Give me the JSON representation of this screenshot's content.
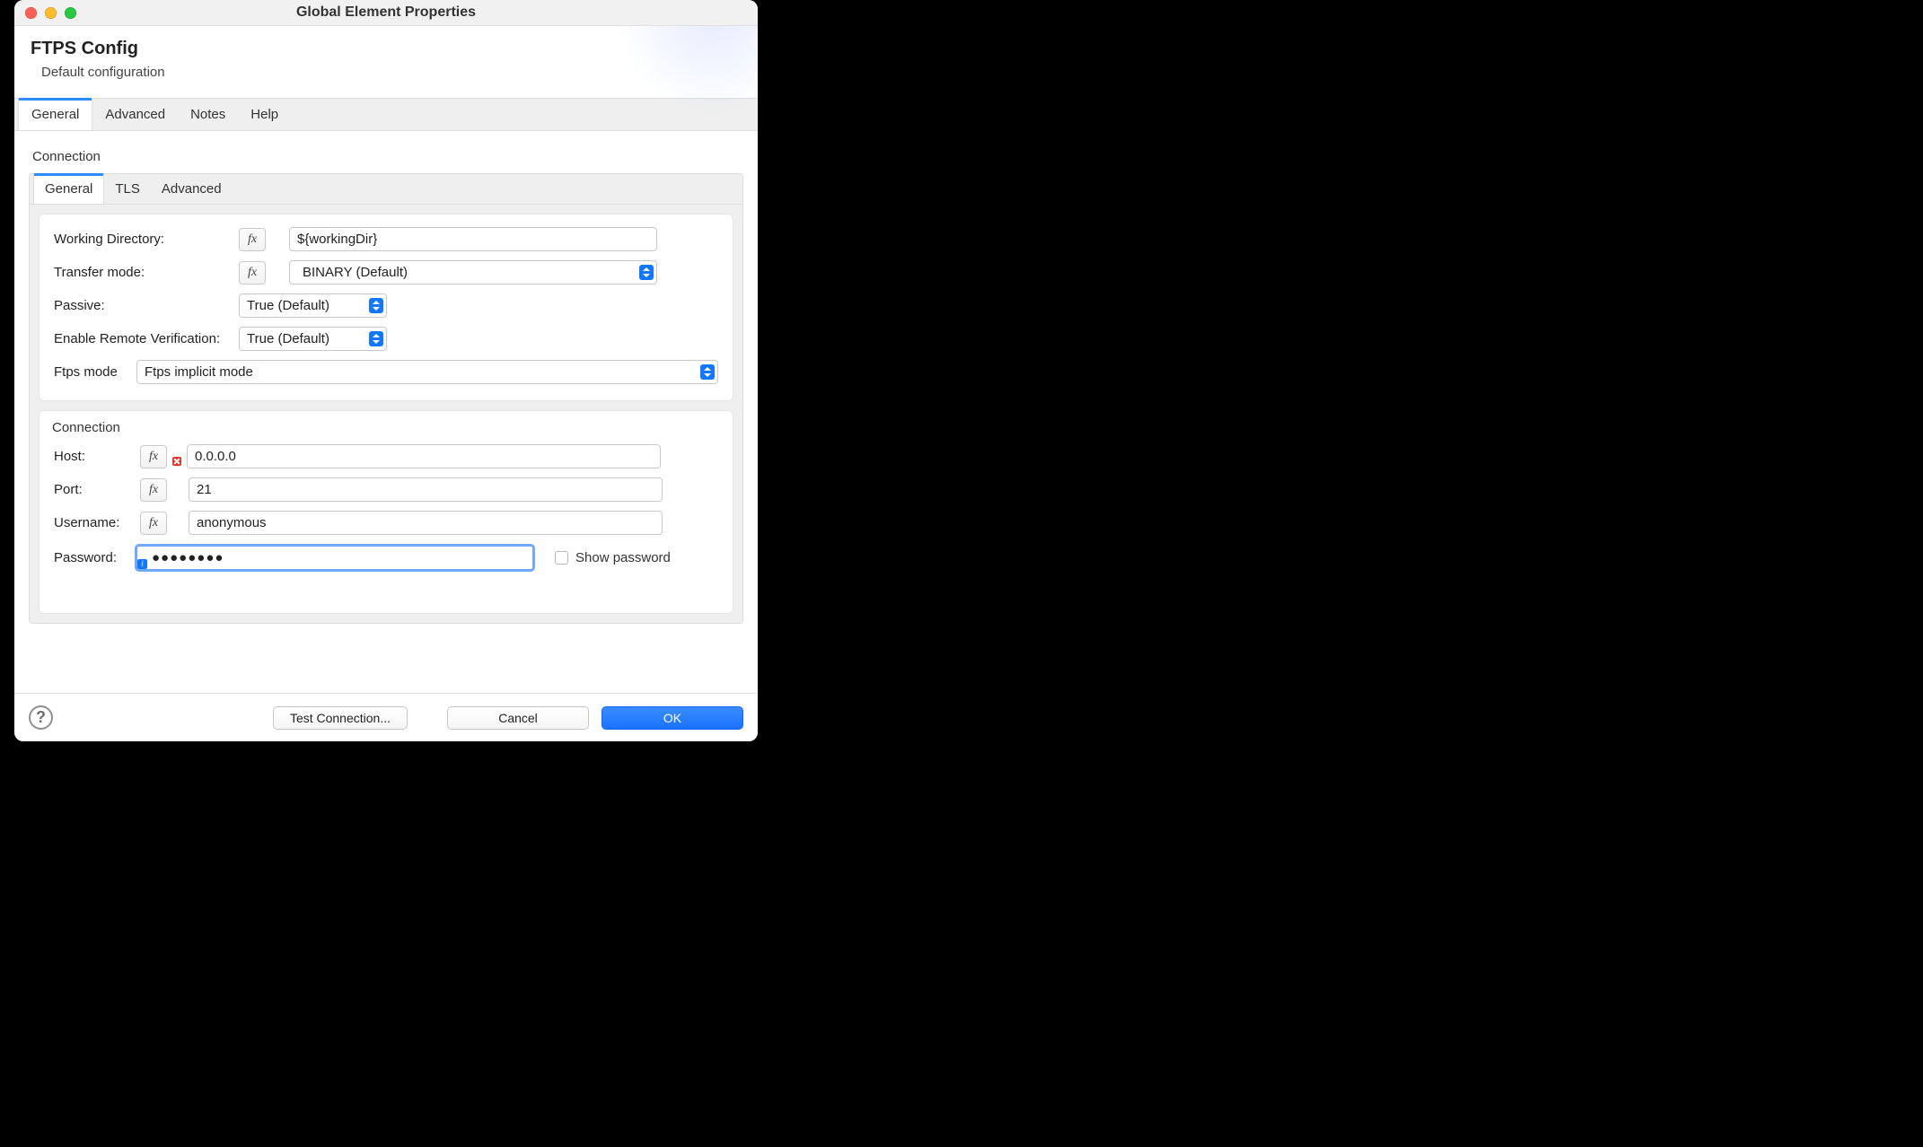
{
  "window": {
    "title": "Global Element Properties"
  },
  "header": {
    "title": "FTPS Config",
    "subtitle": "Default configuration"
  },
  "outerTabs": [
    "General",
    "Advanced",
    "Notes",
    "Help"
  ],
  "section": {
    "connection_label": "Connection"
  },
  "innerTabs": [
    "General",
    "TLS",
    "Advanced"
  ],
  "general_panel": {
    "working_dir_label": "Working Directory:",
    "working_dir_value": "${workingDir}",
    "transfer_mode_label": "Transfer mode:",
    "transfer_mode_value": "BINARY (Default)",
    "passive_label": "Passive:",
    "passive_value": "True (Default)",
    "remote_verif_label": "Enable Remote Verification:",
    "remote_verif_value": "True (Default)",
    "ftps_mode_label": "Ftps mode",
    "ftps_mode_value": "Ftps implicit mode"
  },
  "connection_panel": {
    "title": "Connection",
    "host_label": "Host:",
    "host_value": "0.0.0.0",
    "port_label": "Port:",
    "port_value": "21",
    "username_label": "Username:",
    "username_value": "anonymous",
    "password_label": "Password:",
    "password_value": "●●●●●●●●",
    "show_password_label": "Show password"
  },
  "footer": {
    "test_connection": "Test Connection...",
    "cancel": "Cancel",
    "ok": "OK"
  },
  "fx_label": "fx"
}
